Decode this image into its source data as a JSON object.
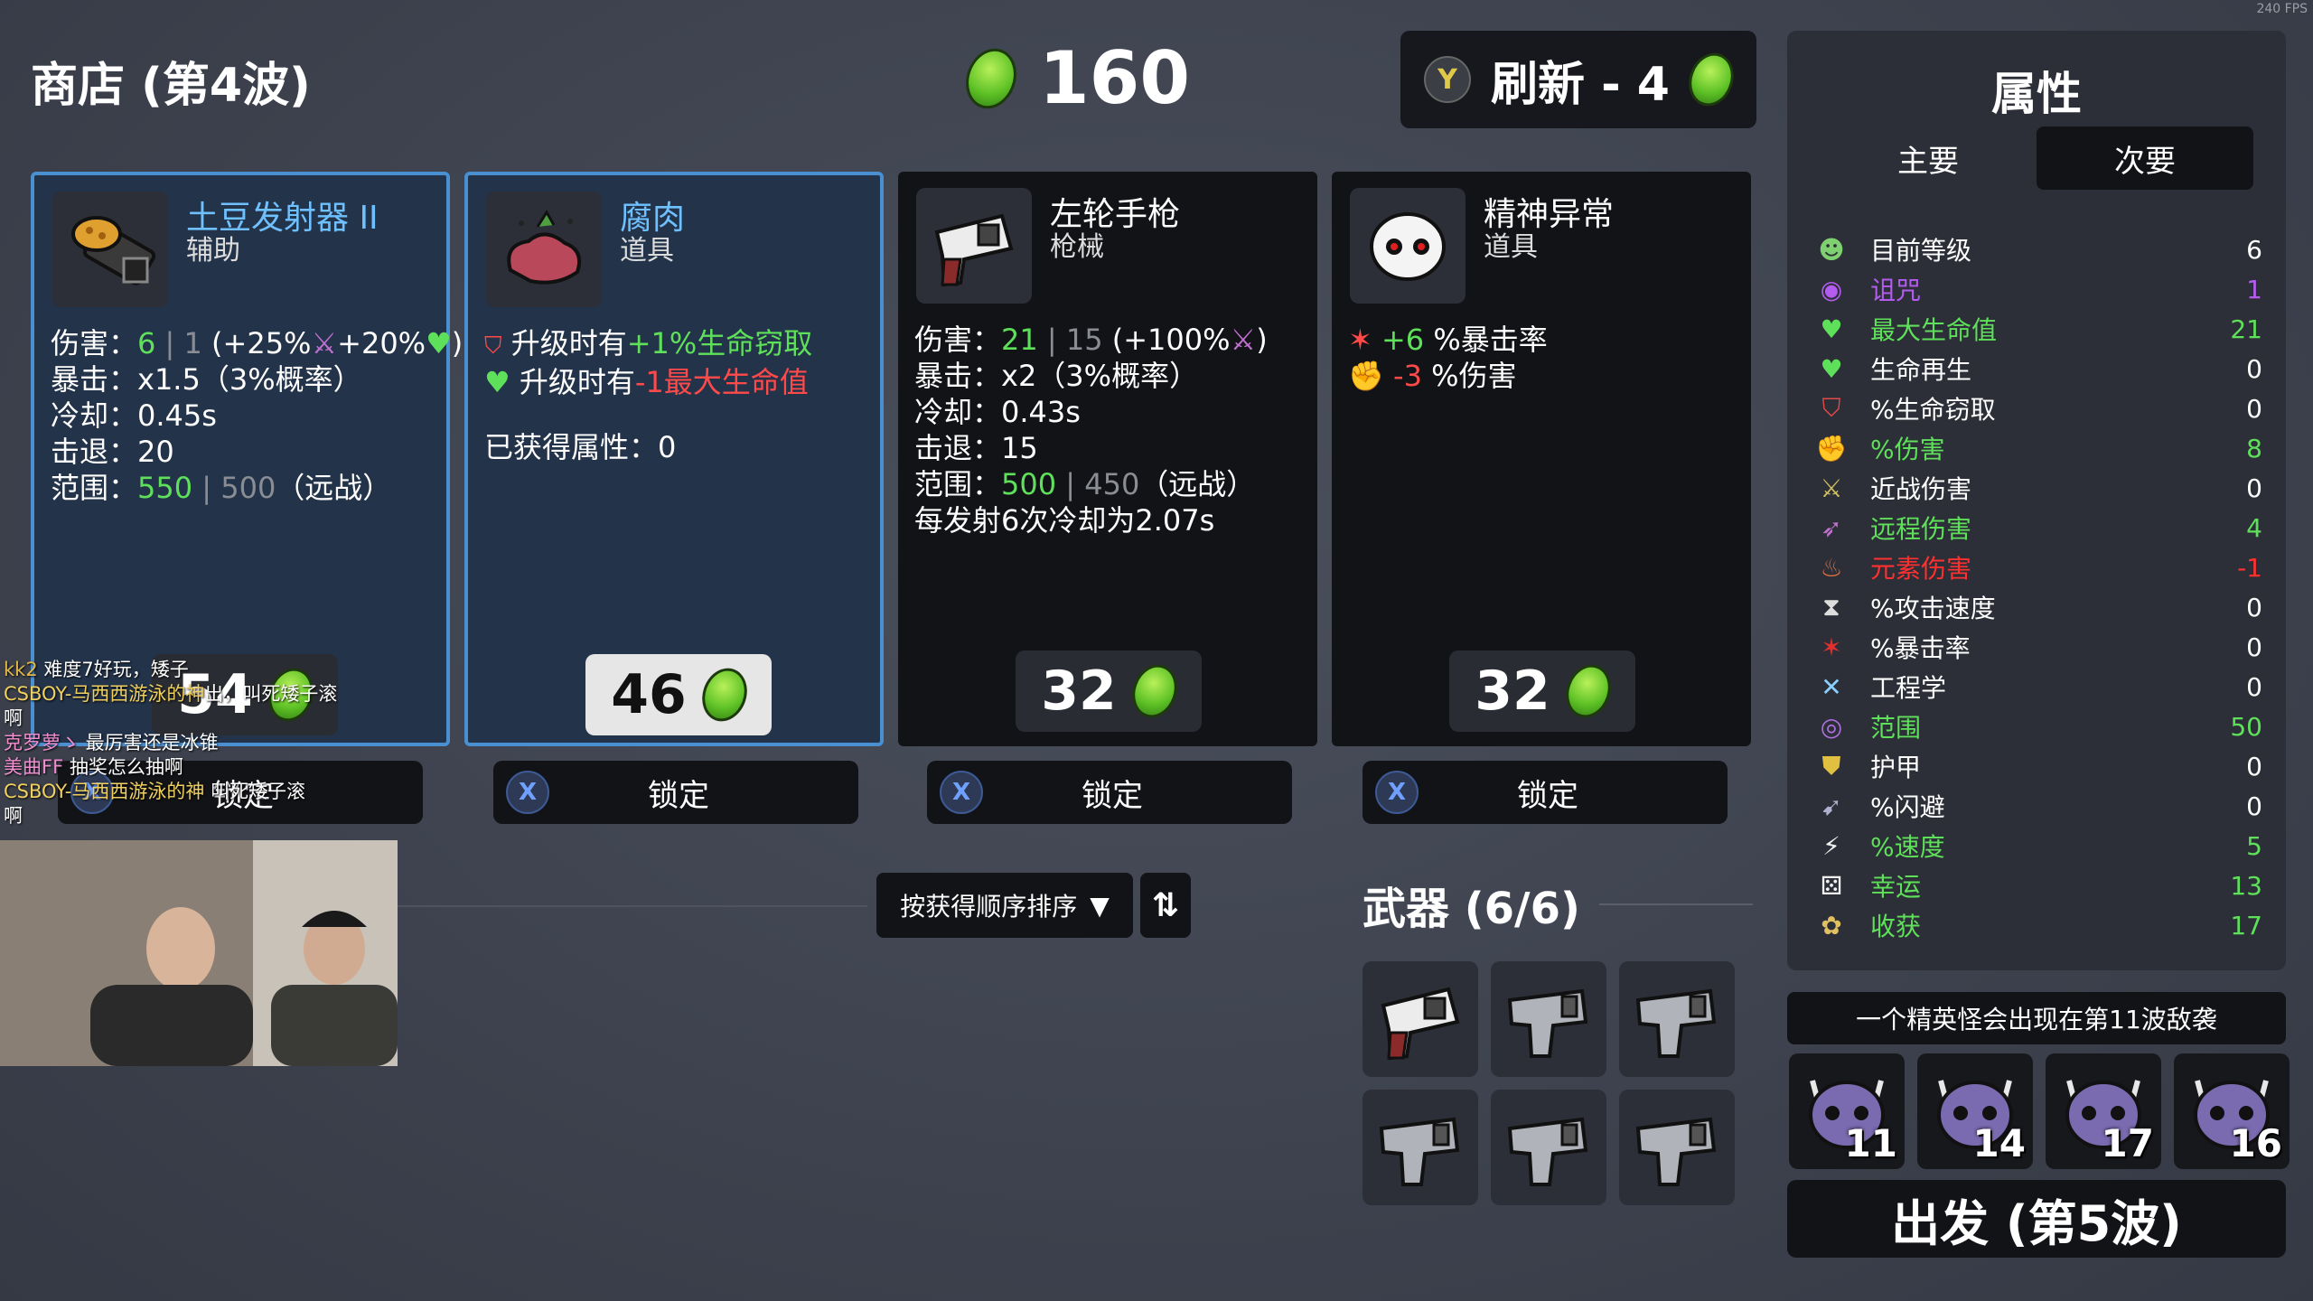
{
  "header": {
    "title": "商店 (第4波)",
    "gold": "160",
    "reroll_key": "Y",
    "reroll_label": "刷新 - 4"
  },
  "fps_overlay": "240 FPS",
  "shop": [
    {
      "name": "土豆发射器 II",
      "type": "辅助",
      "stats": {
        "dmg_label": "伤害：",
        "dmg_val": "6",
        "dmg_sep": " | ",
        "dmg_base": "1",
        "dmg_rest": " (+25%",
        "dmg_rest2": "+20%",
        "dmg_end": ")",
        "crit": "暴击：x1.5（3%概率）",
        "cooldown": "冷却：0.45s",
        "knockback": "击退：20",
        "range_label": "范围：",
        "range_val": "550",
        "range_base": "500",
        "range_rest": "（远战）"
      },
      "price": "54",
      "lock_label": "锁定"
    },
    {
      "name": "腐肉",
      "type": "道具",
      "line1_pre": "升级时有",
      "line1_effect": "+1%生命窃取",
      "line2_pre": "升级时有",
      "line2_effect": "-1最大生命值",
      "acquired": "已获得属性：0",
      "price": "46",
      "lock_label": "锁定"
    },
    {
      "name": "左轮手枪",
      "type": "枪械",
      "stats": {
        "dmg_label": "伤害：",
        "dmg_val": "21",
        "dmg_sep": " | ",
        "dmg_base": "15",
        "dmg_rest": " (+100%",
        "dmg_end": ")",
        "crit": "暴击：x2（3%概率）",
        "cooldown": "冷却：0.43s",
        "knockback": "击退：15",
        "range_label": "范围：",
        "range_val": "500",
        "range_base": "450",
        "range_rest": "（远战）",
        "special": "每发射6次冷却为2.07s"
      },
      "price": "32",
      "lock_label": "锁定"
    },
    {
      "name": "精神异常",
      "type": "道具",
      "line1_val": "+6",
      "line1_text": " %暴击率",
      "line2_val": "-3",
      "line2_text": " %伤害",
      "price": "32",
      "lock_label": "锁定"
    }
  ],
  "panel": {
    "title": "属性",
    "tab_primary": "主要",
    "tab_secondary": "次要",
    "stats": [
      {
        "name": "目前等级",
        "value": "6",
        "color": "#ffffff"
      },
      {
        "name": "诅咒",
        "value": "1",
        "color": "#b45cf0"
      },
      {
        "name": "最大生命值",
        "value": "21",
        "color": "#5fe05a"
      },
      {
        "name": "生命再生",
        "value": "0",
        "color": "#ffffff"
      },
      {
        "name": "%生命窃取",
        "value": "0",
        "color": "#ffffff"
      },
      {
        "name": "%伤害",
        "value": "8",
        "color": "#5fe05a"
      },
      {
        "name": "近战伤害",
        "value": "0",
        "color": "#ffffff"
      },
      {
        "name": "远程伤害",
        "value": "4",
        "color": "#5fe05a"
      },
      {
        "name": "元素伤害",
        "value": "-1",
        "color": "#ff3030"
      },
      {
        "name": "%攻击速度",
        "value": "0",
        "color": "#ffffff"
      },
      {
        "name": "%暴击率",
        "value": "0",
        "color": "#ffffff"
      },
      {
        "name": "工程学",
        "value": "0",
        "color": "#ffffff"
      },
      {
        "name": "范围",
        "value": "50",
        "color": "#5fe05a"
      },
      {
        "name": "护甲",
        "value": "0",
        "color": "#ffffff"
      },
      {
        "name": "%闪避",
        "value": "0",
        "color": "#ffffff"
      },
      {
        "name": "%速度",
        "value": "5",
        "color": "#5fe05a"
      },
      {
        "name": "幸运",
        "value": "13",
        "color": "#5fe05a"
      },
      {
        "name": "收获",
        "value": "17",
        "color": "#5fe05a"
      }
    ]
  },
  "elite_notice": "一个精英怪会出现在第11波敌袭",
  "enemies": [
    "11",
    "14",
    "17",
    "16"
  ],
  "go_button": "出发 (第5波)",
  "weapons": {
    "title": "武器 (6/6)",
    "slots": [
      "revolver-icon",
      "smg-icon",
      "smg-icon",
      "smg-icon",
      "smg-icon",
      "smg-icon"
    ]
  },
  "sort": {
    "label": "按获得顺序排序"
  },
  "chat": [
    {
      "user": "kk2",
      "msg": " 难度7好玩，矮子"
    },
    {
      "user": "CSBOY-马西西游泳的神",
      "msg": "出，叫死矮子滚"
    },
    {
      "user": "",
      "msg": "啊"
    },
    {
      "user": "克罗萝ゝ",
      "msg": " 最厉害还是冰锥"
    },
    {
      "user": "美曲FF",
      "msg": " 抽奖怎么抽啊"
    },
    {
      "user": "CSBOY-马西西游泳的神",
      "msg": " 叫死矮子滚"
    },
    {
      "user": "",
      "msg": "啊"
    }
  ]
}
